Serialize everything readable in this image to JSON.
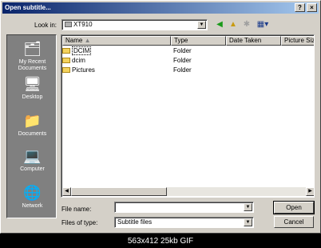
{
  "window": {
    "title": "Open subtitle...",
    "help_label": "?",
    "close_label": "×"
  },
  "lookin": {
    "label": "Look in:",
    "value": "XT910"
  },
  "toolbar": {
    "back_icon": "back-icon",
    "up_icon": "up-folder-icon",
    "newfolder_icon": "new-folder-icon",
    "views_icon": "views-menu-icon"
  },
  "places": [
    {
      "label": "My Recent Documents",
      "icon": "recent-documents-icon"
    },
    {
      "label": "Desktop",
      "icon": "desktop-icon"
    },
    {
      "label": "Documents",
      "icon": "documents-icon"
    },
    {
      "label": "Computer",
      "icon": "computer-icon"
    },
    {
      "label": "Network",
      "icon": "network-icon"
    }
  ],
  "columns": [
    "Name",
    "Type",
    "Date Taken",
    "Picture Size"
  ],
  "files": [
    {
      "name": "DCIM",
      "type": "Folder"
    },
    {
      "name": "dcim",
      "type": "Folder"
    },
    {
      "name": "Pictures",
      "type": "Folder"
    }
  ],
  "filename": {
    "label": "File name:",
    "value": ""
  },
  "filetype": {
    "label": "Files of type:",
    "value": "Subtitle files"
  },
  "buttons": {
    "open": "Open",
    "cancel": "Cancel"
  },
  "caption": "563x412 25kb GIF"
}
